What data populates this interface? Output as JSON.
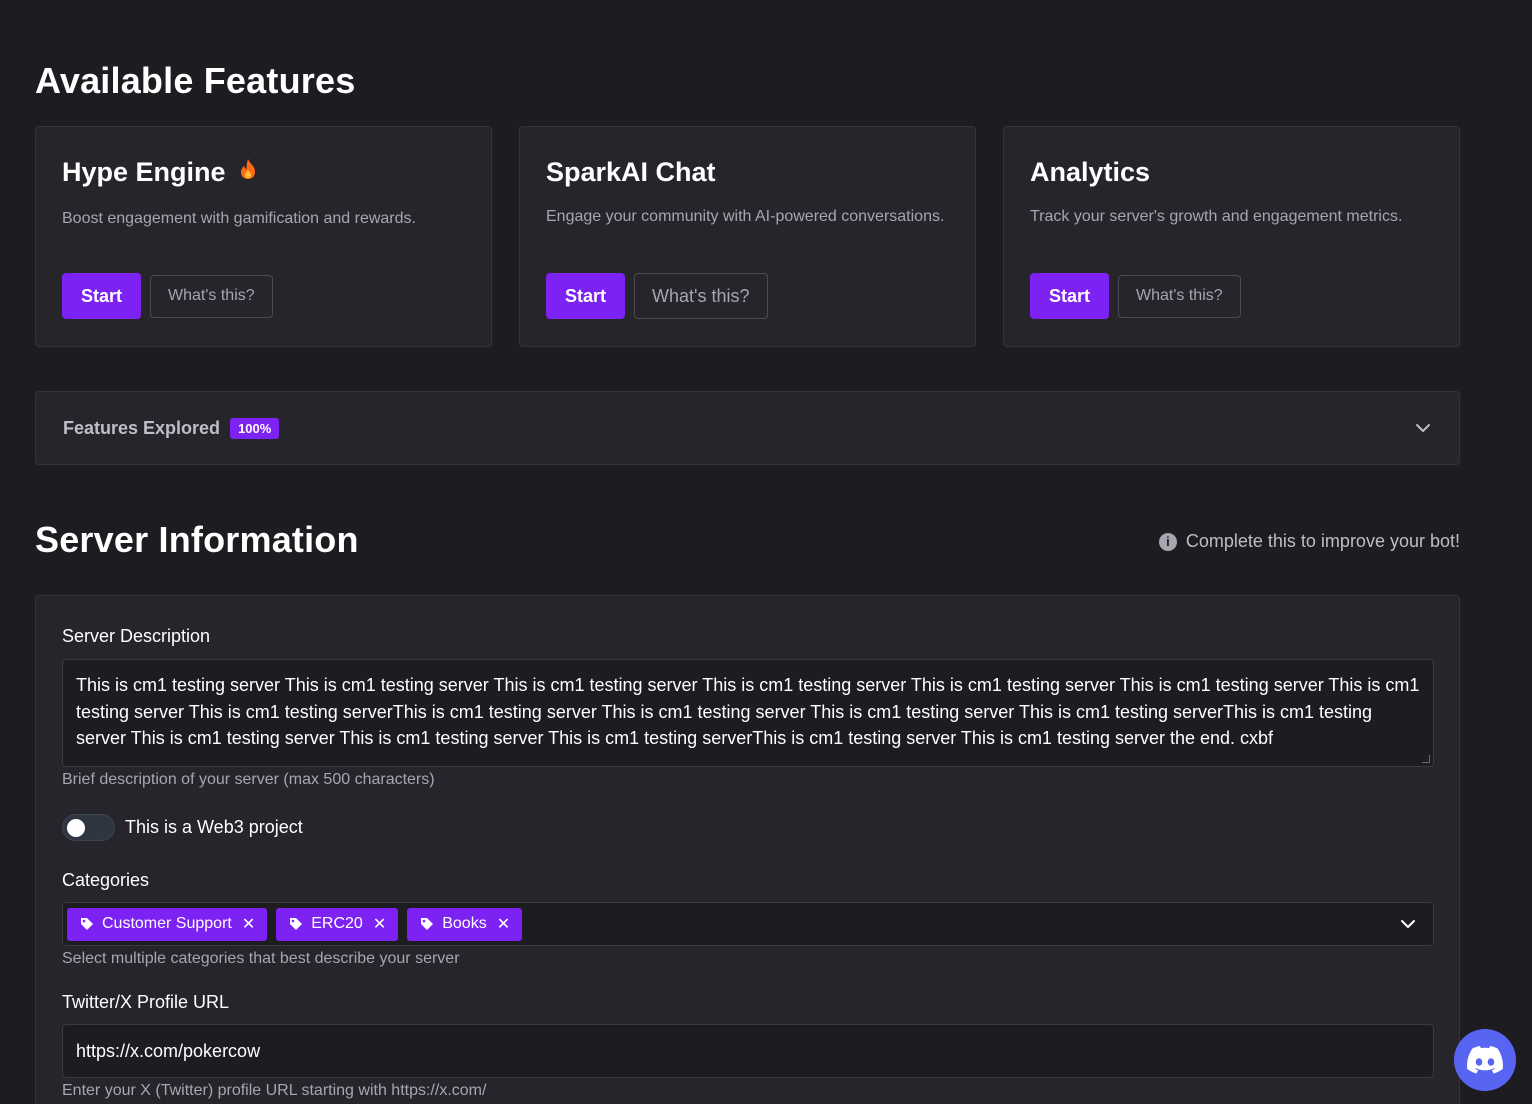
{
  "features": {
    "title": "Available Features",
    "cards": [
      {
        "title": "Hype Engine",
        "icon": "flame-icon",
        "description": "Boost engagement with gamification and rewards.",
        "start_label": "Start",
        "info_label": "What's this?"
      },
      {
        "title": "SparkAI Chat",
        "description": "Engage your community with AI-powered conversations.",
        "start_label": "Start",
        "info_label": "What's this?"
      },
      {
        "title": "Analytics",
        "description": "Track your server's growth and engagement metrics.",
        "start_label": "Start",
        "info_label": "What's this?"
      }
    ],
    "explored_label": "Features Explored",
    "explored_badge": "100%"
  },
  "server_info": {
    "title": "Server Information",
    "hint": "Complete this to improve your bot!",
    "description_label": "Server Description",
    "description_value": "This is cm1 testing server This is cm1 testing server This is cm1 testing server This is cm1 testing server This is cm1 testing server This is cm1 testing server This is cm1 testing server This is cm1 testing serverThis is cm1 testing server This is cm1 testing server This is cm1 testing server This is cm1 testing serverThis is cm1 testing server This is cm1 testing server This is cm1 testing server This is cm1 testing serverThis is cm1 testing server This is cm1 testing server the end.     cxbf",
    "description_help": "Brief description of your server (max 500 characters)",
    "web3_label": "This is a Web3 project",
    "web3_enabled": false,
    "categories_label": "Categories",
    "categories": [
      "Customer Support",
      "ERC20",
      "Books"
    ],
    "categories_help": "Select multiple categories that best describe your server",
    "twitter_label": "Twitter/X Profile URL",
    "twitter_value": "https://x.com/pokercow",
    "twitter_help": "Enter your X (Twitter) profile URL starting with https://x.com/"
  },
  "colors": {
    "accent": "#7c22f2",
    "background": "#1c1c21",
    "card": "#25252b",
    "discord": "#5865f2"
  }
}
